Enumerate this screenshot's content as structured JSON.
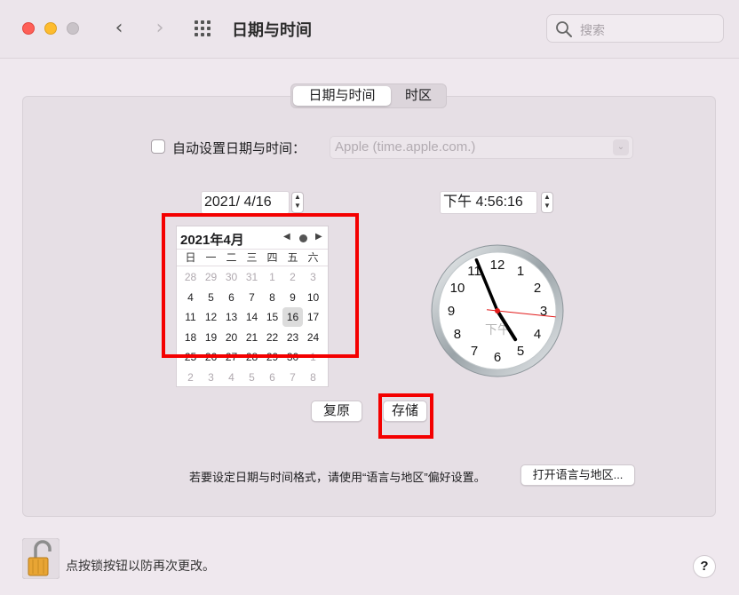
{
  "window": {
    "title": "日期与时间",
    "search_placeholder": "搜索"
  },
  "tabs": [
    {
      "label": "日期与时间",
      "active": true
    },
    {
      "label": "时区",
      "active": false
    }
  ],
  "auto_set": {
    "label": "自动设置日期与时间：",
    "checked": false,
    "server": "Apple (time.apple.com.)"
  },
  "date_field": "2021/  4/16",
  "time_field": "下午  4:56:16",
  "calendar": {
    "title": "2021年4月",
    "weekdays": [
      "日",
      "一",
      "二",
      "三",
      "四",
      "五",
      "六"
    ],
    "weeks": [
      [
        "28",
        "29",
        "30",
        "31",
        "1",
        "2",
        "3"
      ],
      [
        "4",
        "5",
        "6",
        "7",
        "8",
        "9",
        "10"
      ],
      [
        "11",
        "12",
        "13",
        "14",
        "15",
        "16",
        "17"
      ],
      [
        "18",
        "19",
        "20",
        "21",
        "22",
        "23",
        "24"
      ],
      [
        "25",
        "26",
        "27",
        "28",
        "29",
        "30",
        "1"
      ],
      [
        "2",
        "3",
        "4",
        "5",
        "6",
        "7",
        "8"
      ]
    ],
    "selected": "16"
  },
  "clock": {
    "numbers": [
      "12",
      "1",
      "2",
      "3",
      "4",
      "5",
      "6",
      "7",
      "8",
      "9",
      "10",
      "11"
    ],
    "ampm": "下午",
    "hour": 4,
    "minute": 56,
    "second": 16
  },
  "buttons": {
    "revert": "复原",
    "save": "存储",
    "open_language": "打开语言与地区..."
  },
  "note": "若要设定日期与时间格式，请使用“语言与地区”偏好设置。",
  "lock_label": "点按锁按钮以防再次更改。",
  "help": "?"
}
